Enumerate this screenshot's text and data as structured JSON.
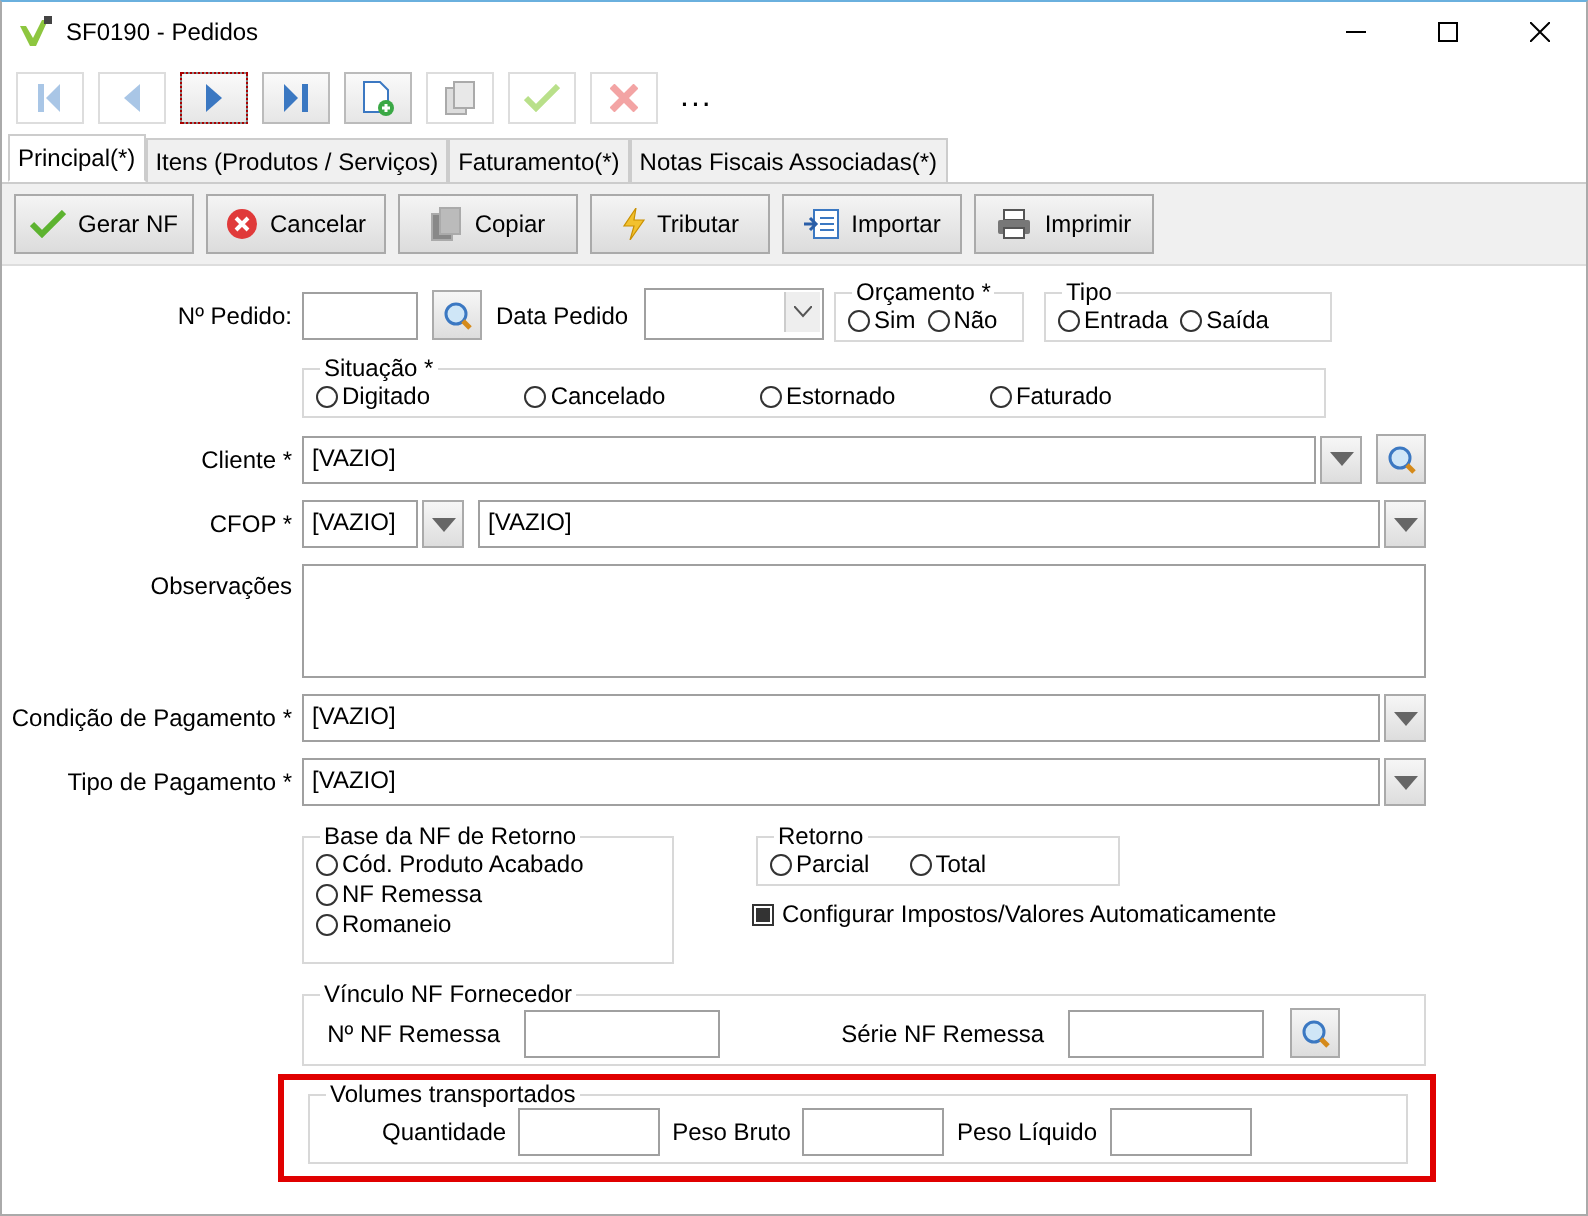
{
  "window": {
    "title": "SF0190 - Pedidos"
  },
  "toolbar": [
    {
      "kind": "first",
      "disabled": true,
      "focused": false
    },
    {
      "kind": "prev",
      "disabled": true,
      "focused": false
    },
    {
      "kind": "next",
      "disabled": false,
      "focused": true
    },
    {
      "kind": "last",
      "disabled": false,
      "focused": false
    },
    {
      "kind": "new",
      "disabled": false,
      "focused": false
    },
    {
      "kind": "copy",
      "disabled": true,
      "focused": false
    },
    {
      "kind": "confirm",
      "disabled": true,
      "focused": false
    },
    {
      "kind": "cancel",
      "disabled": true,
      "focused": false
    }
  ],
  "toolbar_more": "...",
  "tabs": [
    {
      "label": "Principal(*)",
      "selected": true
    },
    {
      "label": "Itens (Produtos / Serviços)",
      "selected": false
    },
    {
      "label": "Faturamento(*)",
      "selected": false
    },
    {
      "label": "Notas Fiscais Associadas(*)",
      "selected": false
    }
  ],
  "actions": [
    {
      "kind": "check",
      "label": "Gerar NF"
    },
    {
      "kind": "cancel",
      "label": "Cancelar"
    },
    {
      "kind": "copy",
      "label": "Copiar"
    },
    {
      "kind": "bolt",
      "label": "Tributar"
    },
    {
      "kind": "import",
      "label": "Importar"
    },
    {
      "kind": "print",
      "label": "Imprimir"
    }
  ],
  "form": {
    "pedido_label": "Nº Pedido:",
    "data_label": "Data Pedido",
    "orcamento": {
      "title": "Orçamento *",
      "options": [
        {
          "label": "Sim",
          "selected": false
        },
        {
          "label": "Não",
          "selected": false
        }
      ]
    },
    "tipo": {
      "title": "Tipo",
      "options": [
        {
          "label": "Entrada",
          "selected": false
        },
        {
          "label": "Saída",
          "selected": false
        }
      ]
    },
    "situacao": {
      "title": "Situação *",
      "options": [
        {
          "label": "Digitado",
          "selected": false
        },
        {
          "label": "Cancelado",
          "selected": false
        },
        {
          "label": "Estornado",
          "selected": false
        },
        {
          "label": "Faturado",
          "selected": false
        }
      ]
    },
    "cliente": {
      "label": "Cliente *",
      "value": "[VAZIO]"
    },
    "cfop": {
      "label": "CFOP *",
      "code": "[VAZIO]",
      "value": "[VAZIO]"
    },
    "observacoes": {
      "label": "Observações"
    },
    "condicao": {
      "label": "Condição de Pagamento *",
      "value": "[VAZIO]"
    },
    "tipo_pagamento": {
      "label": "Tipo de Pagamento *",
      "value": "[VAZIO]"
    },
    "base": {
      "title": "Base da NF de Retorno",
      "options": [
        {
          "label": "Cód. Produto Acabado",
          "selected": false
        },
        {
          "label": "NF Remessa",
          "selected": false
        },
        {
          "label": "Romaneio",
          "selected": false
        }
      ]
    },
    "retorno": {
      "title": "Retorno",
      "options": [
        {
          "label": "Parcial",
          "selected": false
        },
        {
          "label": "Total",
          "selected": false
        }
      ]
    },
    "auto_config": {
      "label": "Configurar Impostos/Valores Automaticamente",
      "checked": true
    },
    "vinculo": {
      "title": "Vínculo NF Fornecedor",
      "nf_label": "Nº NF Remessa",
      "serie_label": "Série NF Remessa"
    },
    "volumes": {
      "title": "Volumes transportados",
      "highlighted": true,
      "fields": [
        "Quantidade",
        "Peso Bruto",
        "Peso Líquido"
      ]
    }
  }
}
